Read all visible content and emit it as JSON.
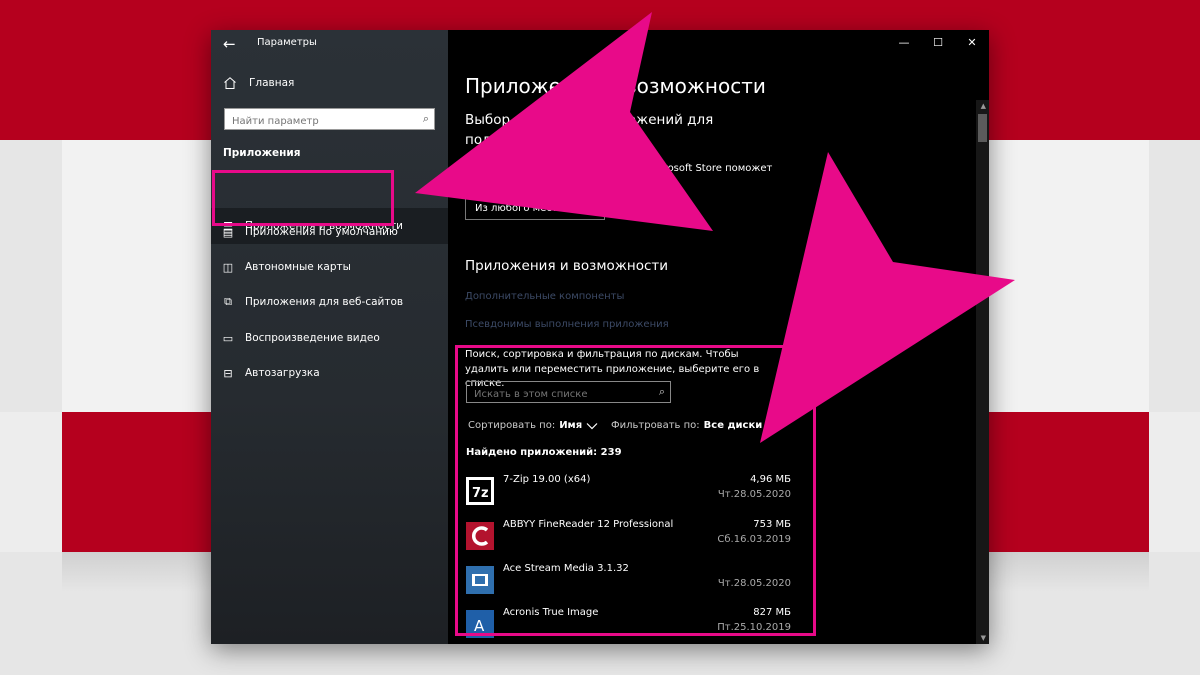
{
  "window": {
    "title": "Параметры",
    "controls": {
      "minimize": "—",
      "maximize": "☐",
      "close": "✕"
    }
  },
  "sidebar": {
    "home": "Главная",
    "search_placeholder": "Найти параметр",
    "section": "Приложения",
    "items": [
      {
        "label": "Приложения и возможности",
        "icon": "list-icon"
      },
      {
        "label": "Приложения по умолчанию",
        "icon": "default-apps-icon"
      },
      {
        "label": "Автономные карты",
        "icon": "map-icon"
      },
      {
        "label": "Приложения для веб-сайтов",
        "icon": "web-app-icon"
      },
      {
        "label": "Воспроизведение видео",
        "icon": "video-icon"
      },
      {
        "label": "Автозагрузка",
        "icon": "startup-icon"
      }
    ]
  },
  "main": {
    "title": "Приложения и возможности",
    "subheading": "Выбор источника приложений для получения приложений",
    "description": "Установка приложений только из Microsoft Store поможет",
    "source_select": "Из любого места",
    "apps_heading": "Приложения и возможности",
    "link_optional": "Дополнительные компоненты",
    "link_aliases": "Псевдонимы выполнения приложения",
    "list_description": "Поиск, сортировка и фильтрация по дискам. Чтобы удалить или переместить приложение, выберите его в списке.",
    "list_search_placeholder": "Искать в этом списке",
    "sort_label": "Сортировать по:",
    "sort_value": "Имя",
    "filter_label": "Фильтровать по:",
    "filter_value": "Все диски",
    "count": "Найдено приложений: 239",
    "apps": [
      {
        "name": "7-Zip 19.00 (x64)",
        "size": "4,96 МБ",
        "date": "Чт.28.05.2020"
      },
      {
        "name": "ABBYY FineReader 12 Professional",
        "size": "753 МБ",
        "date": "Сб.16.03.2019"
      },
      {
        "name": "Ace Stream Media 3.1.32",
        "size": "",
        "date": "Чт.28.05.2020"
      },
      {
        "name": "Acronis True Image",
        "size": "827 МБ",
        "date": "Пт.25.10.2019"
      }
    ]
  },
  "colors": {
    "highlight": "#e80a89",
    "banner_red": "#b5001e"
  }
}
